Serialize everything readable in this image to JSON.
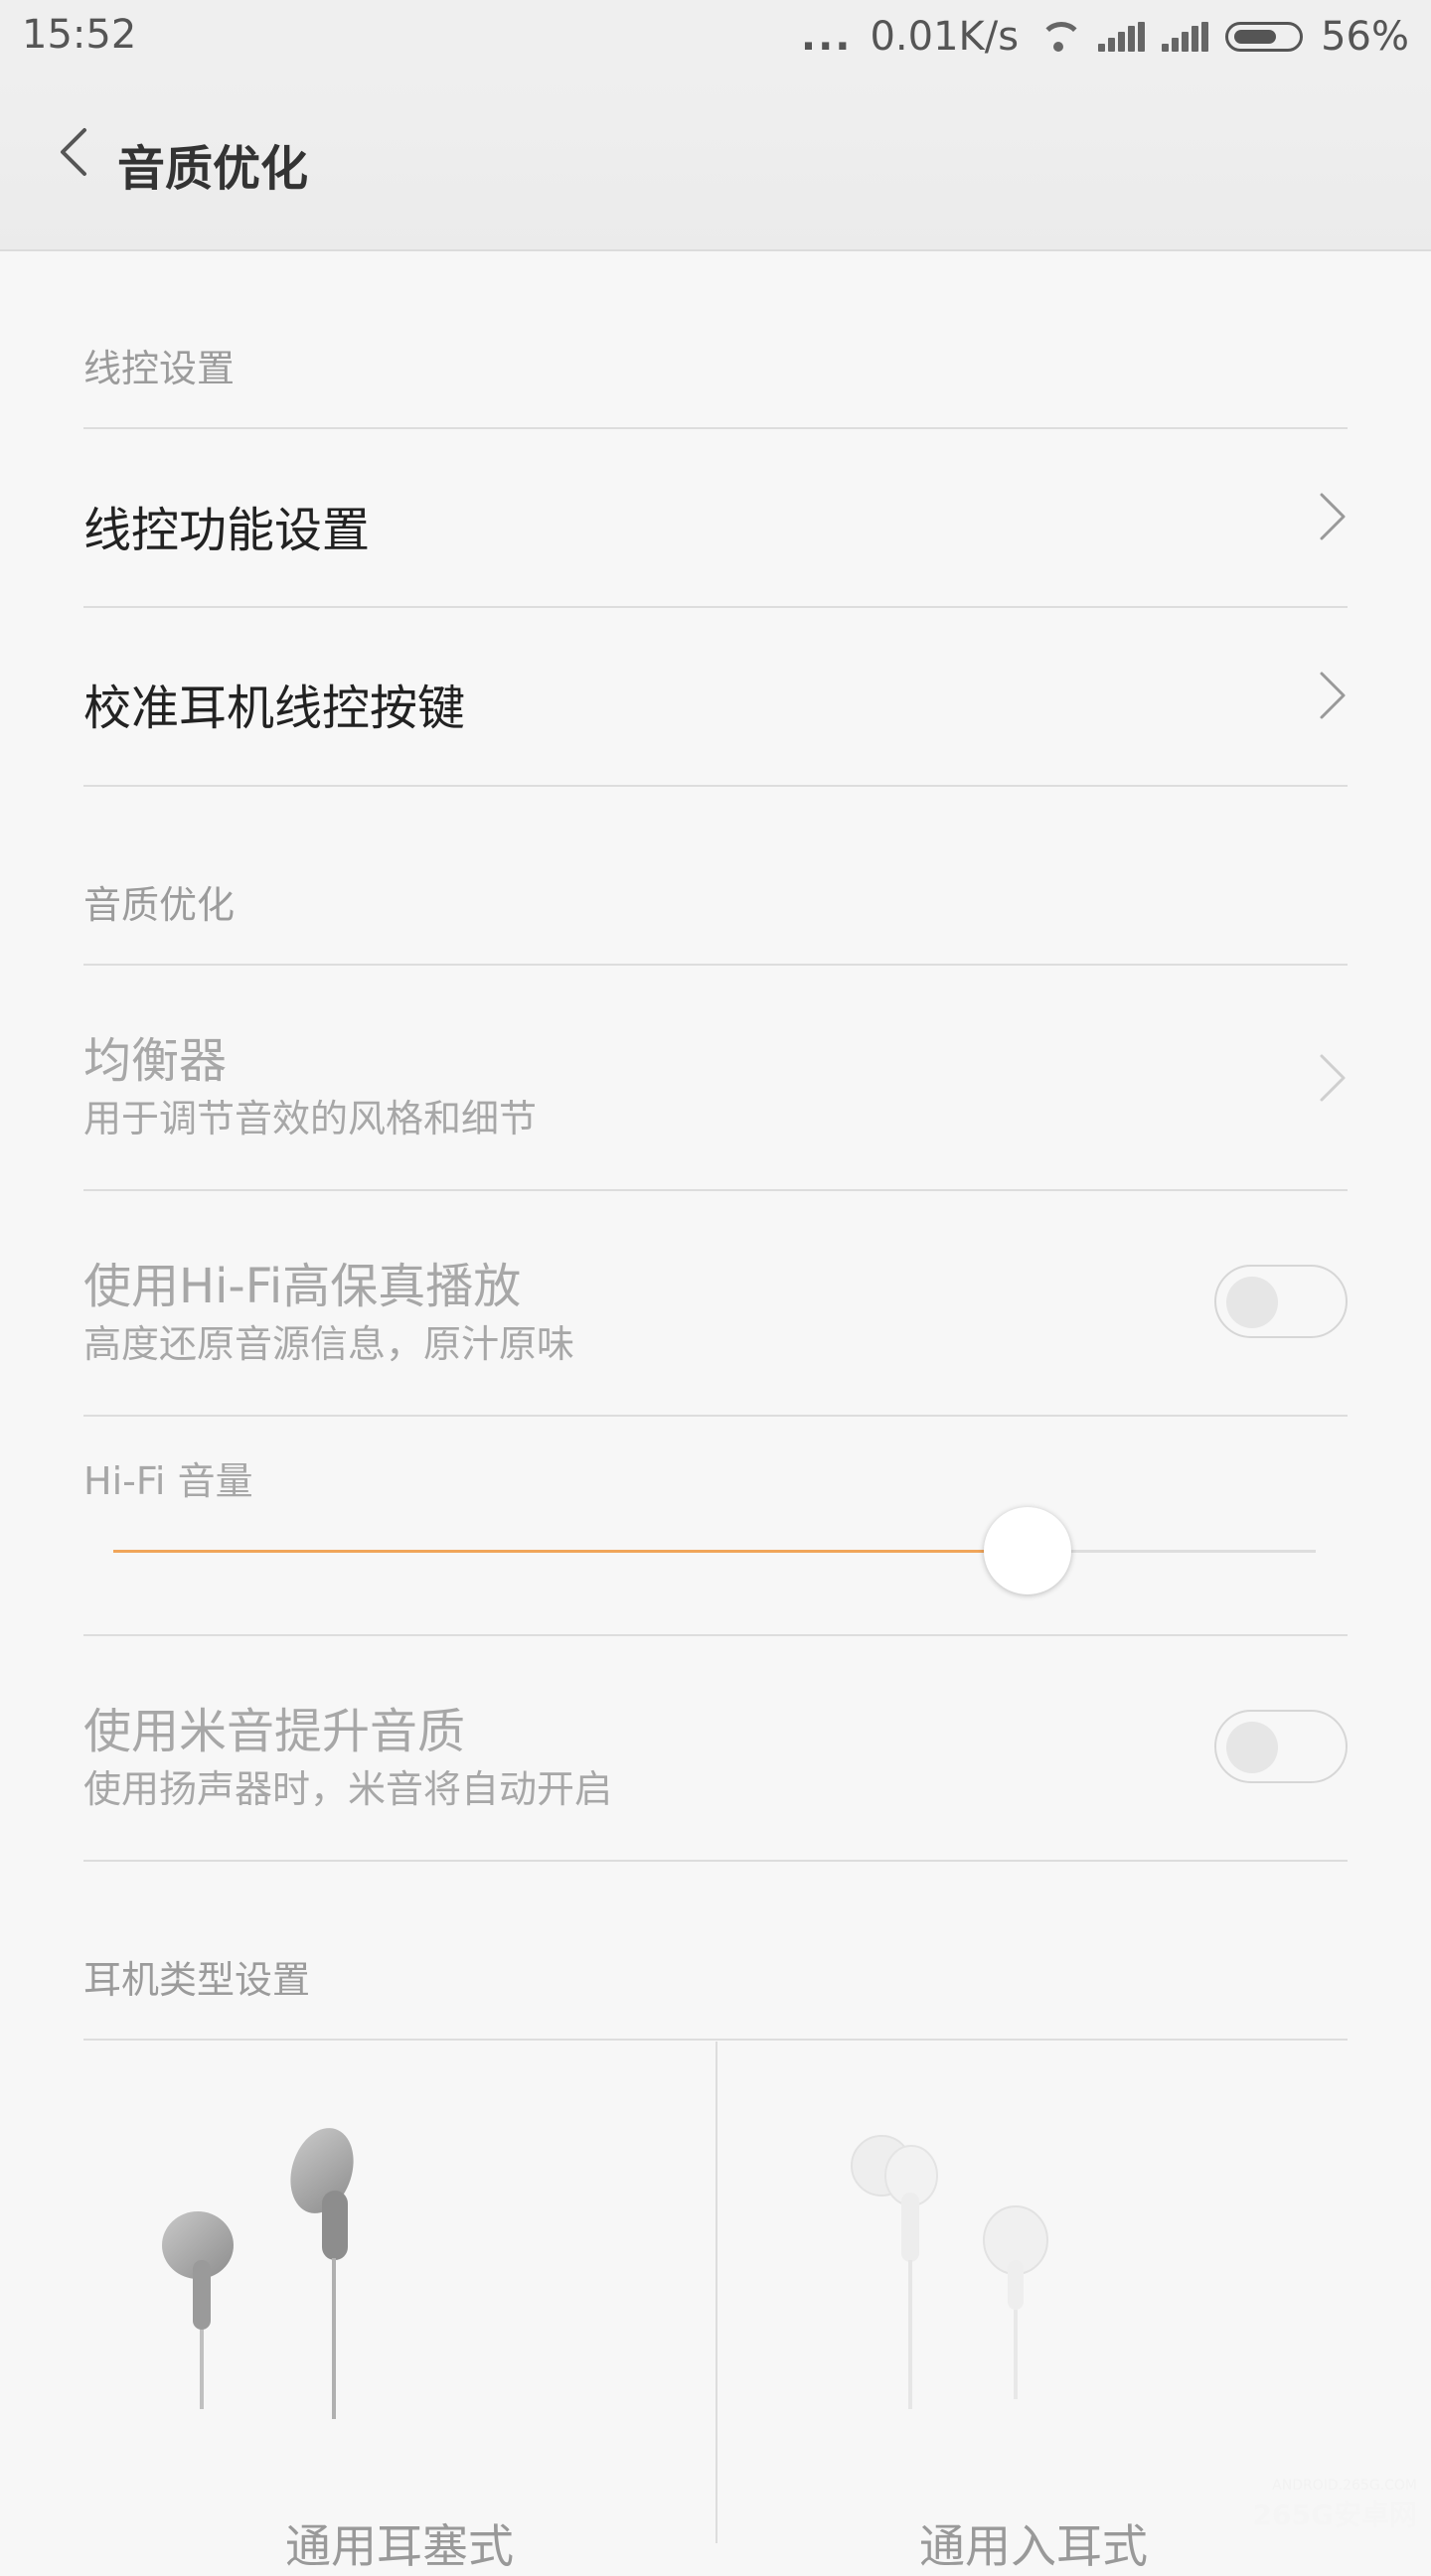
{
  "status": {
    "time": "15:52",
    "dots": "...",
    "speed": "0.01K/s",
    "battery": "56%"
  },
  "header": {
    "title": "音质优化"
  },
  "sections": {
    "remote": {
      "header": "线控设置",
      "items": [
        {
          "title": "线控功能设置"
        },
        {
          "title": "校准耳机线控按键"
        }
      ]
    },
    "quality": {
      "header": "音质优化",
      "equalizer": {
        "title": "均衡器",
        "subtitle": "用于调节音效的风格和细节"
      },
      "hifi": {
        "title": "使用Hi-Fi高保真播放",
        "subtitle": "高度还原音源信息，原汁原味",
        "enabled": false
      },
      "hifi_volume": {
        "label": "Hi-Fi 音量",
        "level": 0.76
      },
      "mi_sound": {
        "title": "使用米音提升音质",
        "subtitle": "使用扬声器时，米音将自动开启",
        "enabled": false
      }
    },
    "earphone_type": {
      "header": "耳机类型设置",
      "options": [
        {
          "label": "通用耳塞式"
        },
        {
          "label": "通用入耳式"
        }
      ]
    }
  },
  "watermark": {
    "top": "ANDROID.265G.COM",
    "bottom": "265G安卓网"
  },
  "colors": {
    "accent": "#f0a55a",
    "background": "#f7f7f7",
    "divider": "#dddddd"
  }
}
